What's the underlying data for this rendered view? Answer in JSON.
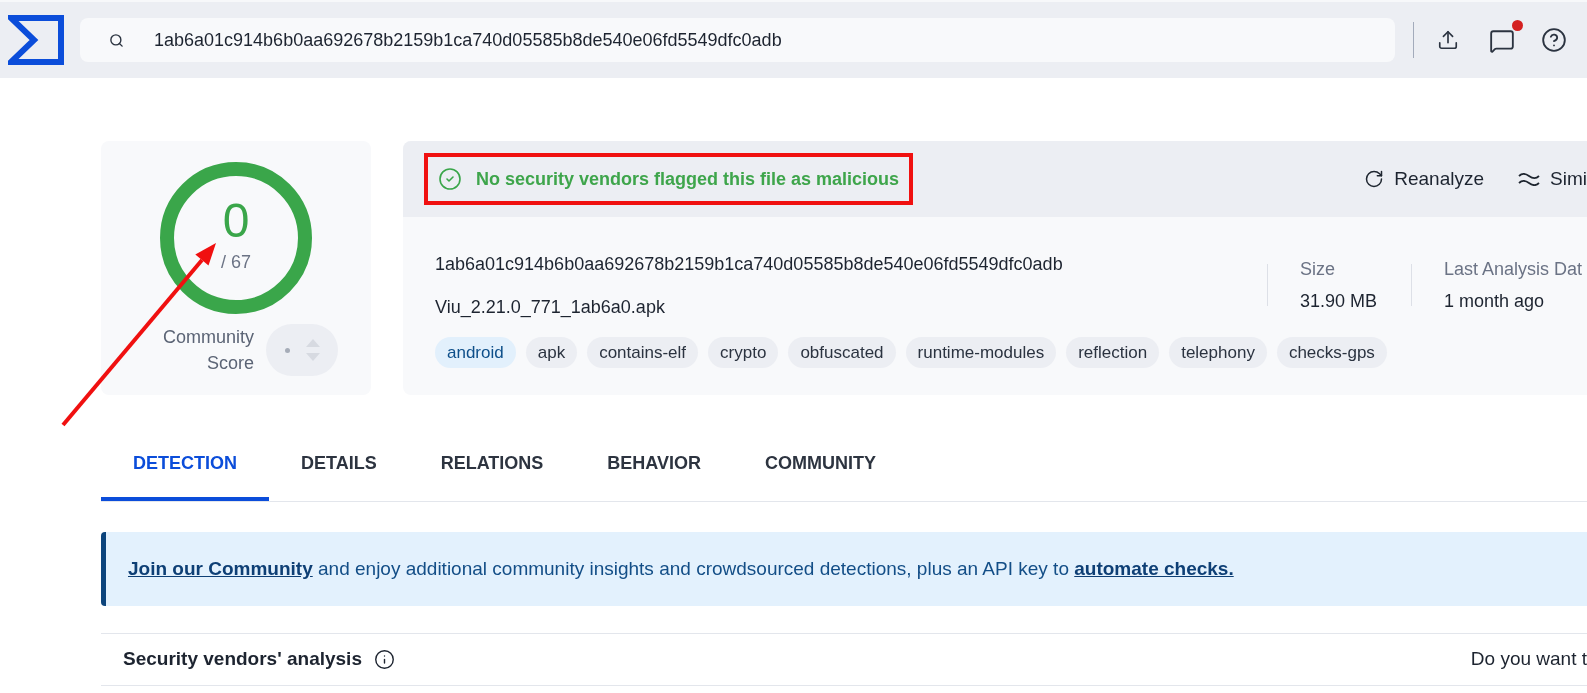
{
  "top_bar": {
    "search": {
      "value": "1ab6a01c914b6b0aa692678b2159b1ca740d05585b8de540e06fd5549dfc0adb"
    },
    "notifications": {
      "unread": true
    }
  },
  "score": {
    "value": "0",
    "total": "/ 67",
    "label": "Community Score"
  },
  "summary": {
    "status": "No security vendors flagged this file as malicious",
    "actions": [
      {
        "kind": "reanalyze",
        "label": "Reanalyze"
      },
      {
        "kind": "similar",
        "label": "Simi"
      }
    ],
    "hash": "1ab6a01c914b6b0aa692678b2159b1ca740d05585b8de540e06fd5549dfc0adb",
    "file_name": "Viu_2.21.0_771_1ab6a0.apk",
    "stats": [
      {
        "label": "Size",
        "value": "31.90 MB"
      },
      {
        "label": "Last Analysis Dat",
        "value": "1 month ago"
      }
    ],
    "tags": [
      {
        "label": "android",
        "highlighted": true
      },
      {
        "label": "apk",
        "highlighted": false
      },
      {
        "label": "contains-elf",
        "highlighted": false
      },
      {
        "label": "crypto",
        "highlighted": false
      },
      {
        "label": "obfuscated",
        "highlighted": false
      },
      {
        "label": "runtime-modules",
        "highlighted": false
      },
      {
        "label": "reflection",
        "highlighted": false
      },
      {
        "label": "telephony",
        "highlighted": false
      },
      {
        "label": "checks-gps",
        "highlighted": false
      }
    ]
  },
  "tabs": [
    {
      "label": "DETECTION",
      "selected": true
    },
    {
      "label": "DETAILS",
      "selected": false
    },
    {
      "label": "RELATIONS",
      "selected": false
    },
    {
      "label": "BEHAVIOR",
      "selected": false
    },
    {
      "label": "COMMUNITY",
      "selected": false
    }
  ],
  "banner": {
    "parts": [
      {
        "kind": "link",
        "text": "Join our Community"
      },
      {
        "kind": "text",
        "text": "and enjoy additional community insights and crowdsourced detections, plus an API key to"
      },
      {
        "kind": "link",
        "text": "automate checks."
      }
    ]
  },
  "vendors_section": {
    "title": "Security vendors' analysis",
    "prompt": "Do you want t"
  }
}
